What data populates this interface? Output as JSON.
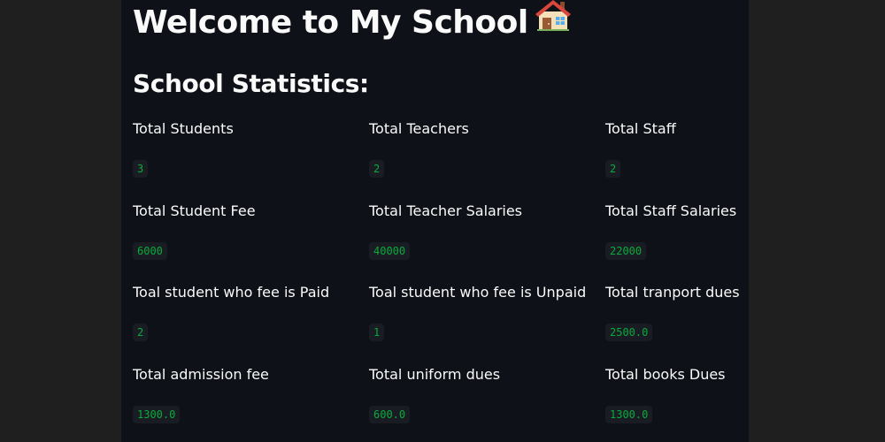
{
  "page": {
    "title": "Welcome to My School",
    "title_icon": "house-icon",
    "subtitle": "School Statistics:"
  },
  "stats": [
    {
      "label": "Total Students",
      "value": "3"
    },
    {
      "label": "Total Teachers",
      "value": "2"
    },
    {
      "label": "Total Staff",
      "value": "2"
    },
    {
      "label": "Total Student Fee",
      "value": "6000"
    },
    {
      "label": "Total Teacher Salaries",
      "value": "40000"
    },
    {
      "label": "Total Staff Salaries",
      "value": "22000"
    },
    {
      "label": "Toal student who fee is Paid",
      "value": "2"
    },
    {
      "label": "Toal student who fee is Unpaid",
      "value": "1"
    },
    {
      "label": "Total tranport dues",
      "value": "2500.0"
    },
    {
      "label": "Total admission fee",
      "value": "1300.0"
    },
    {
      "label": "Total uniform dues",
      "value": "600.0"
    },
    {
      "label": "Total books Dues",
      "value": "1300.0"
    }
  ],
  "colors": {
    "app_background": "#0e1117",
    "outer_background": "#1f1f1f",
    "text": "#fafafa",
    "code_text": "#09ab3b",
    "code_background": "#1a1c24"
  }
}
